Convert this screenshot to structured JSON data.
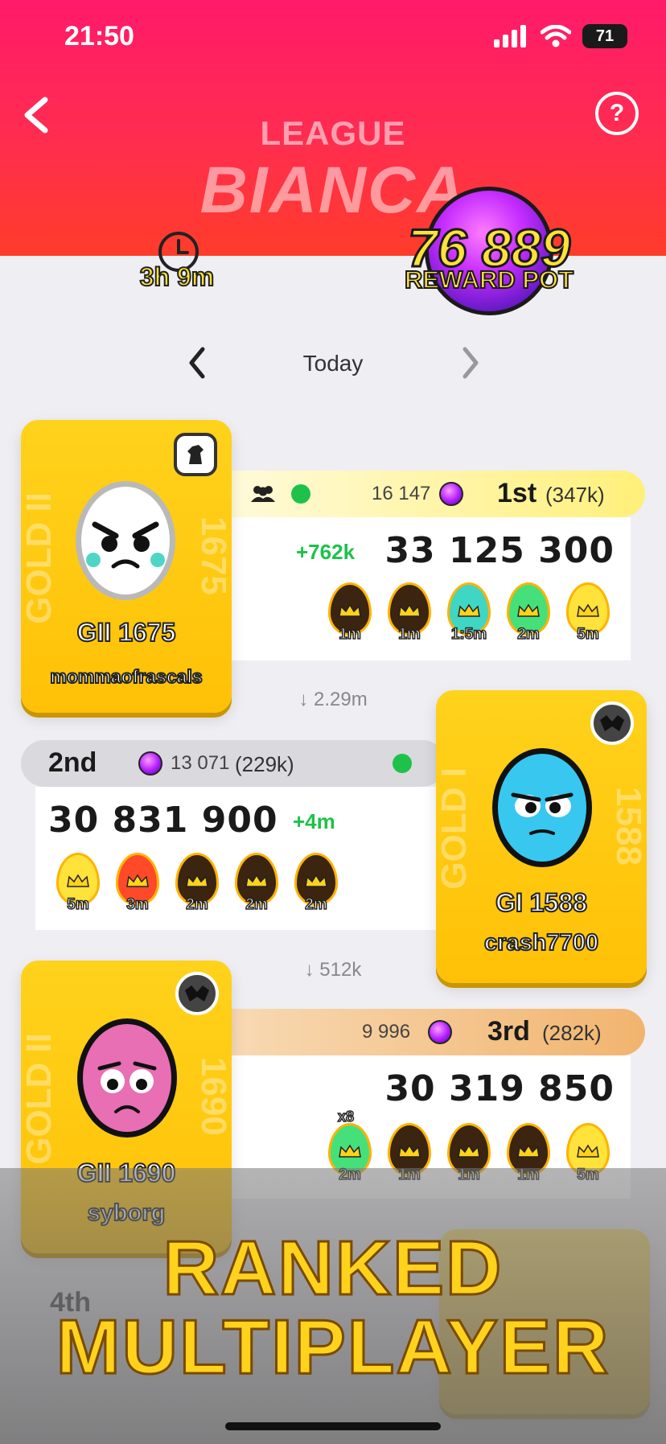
{
  "status_bar": {
    "time": "21:50",
    "battery": "71"
  },
  "header": {
    "league_label": "LEAGUE",
    "league_name": "BIANCA"
  },
  "timer": {
    "remaining": "3h 9m"
  },
  "reward_pot": {
    "value": "76 889",
    "label": "REWARD POT"
  },
  "day_nav": {
    "label": "Today"
  },
  "players": [
    {
      "rank": "1st",
      "rank_points": "(347k)",
      "gems": "16 147",
      "gain": "+762k",
      "score": "33 125 300",
      "level": "GII  1675",
      "username": "mommaofrascals",
      "tier_side": "GOLD II",
      "side_number": "1675",
      "eggs": [
        {
          "time": "1m",
          "color": "#3b2410"
        },
        {
          "time": "1m",
          "color": "#3b2410"
        },
        {
          "time": "1:5m",
          "color": "#3fd6c4"
        },
        {
          "time": "2m",
          "color": "#46e07a"
        },
        {
          "time": "5m",
          "color": "#ffe23a"
        }
      ]
    },
    {
      "rank": "2nd",
      "rank_points": "(229k)",
      "gems": "13 071",
      "gain": "+4m",
      "score": "30 831 900",
      "level": "GI  1588",
      "username": "crash7700",
      "tier_side": "GOLD I",
      "side_number": "1588",
      "eggs": [
        {
          "time": "5m",
          "color": "#ffe23a"
        },
        {
          "time": "3m",
          "color": "#ff4a2a"
        },
        {
          "time": "2m",
          "color": "#3b2410"
        },
        {
          "time": "2m",
          "color": "#3b2410"
        },
        {
          "time": "2m",
          "color": "#3b2410"
        }
      ]
    },
    {
      "rank": "3rd",
      "rank_points": "(282k)",
      "gems": "9 996",
      "score": "30 319 850",
      "level": "GII  1690",
      "username": "syborg",
      "tier_side": "GOLD II",
      "side_number": "1690",
      "first_egg_multiplier": "x8",
      "eggs": [
        {
          "time": "2m",
          "color": "#46e07a"
        },
        {
          "time": "1m",
          "color": "#3b2410"
        },
        {
          "time": "1m",
          "color": "#3b2410"
        },
        {
          "time": "1m",
          "color": "#3b2410"
        },
        {
          "time": "5m",
          "color": "#ffe23a"
        }
      ]
    }
  ],
  "gaps": [
    "↓ 2.29m",
    "↓ 512k"
  ],
  "fourth_rank": "4th",
  "promo": {
    "line1": "RANKED",
    "line2": "MULTIPLAYER"
  },
  "colors": {
    "gold": "#ffc107",
    "header": "#ff2d4f",
    "gain_green": "#1ec24a",
    "first_bar": "#fff07a",
    "second_bar": "#d6d6dc",
    "third_bar": "#f1b46e"
  }
}
